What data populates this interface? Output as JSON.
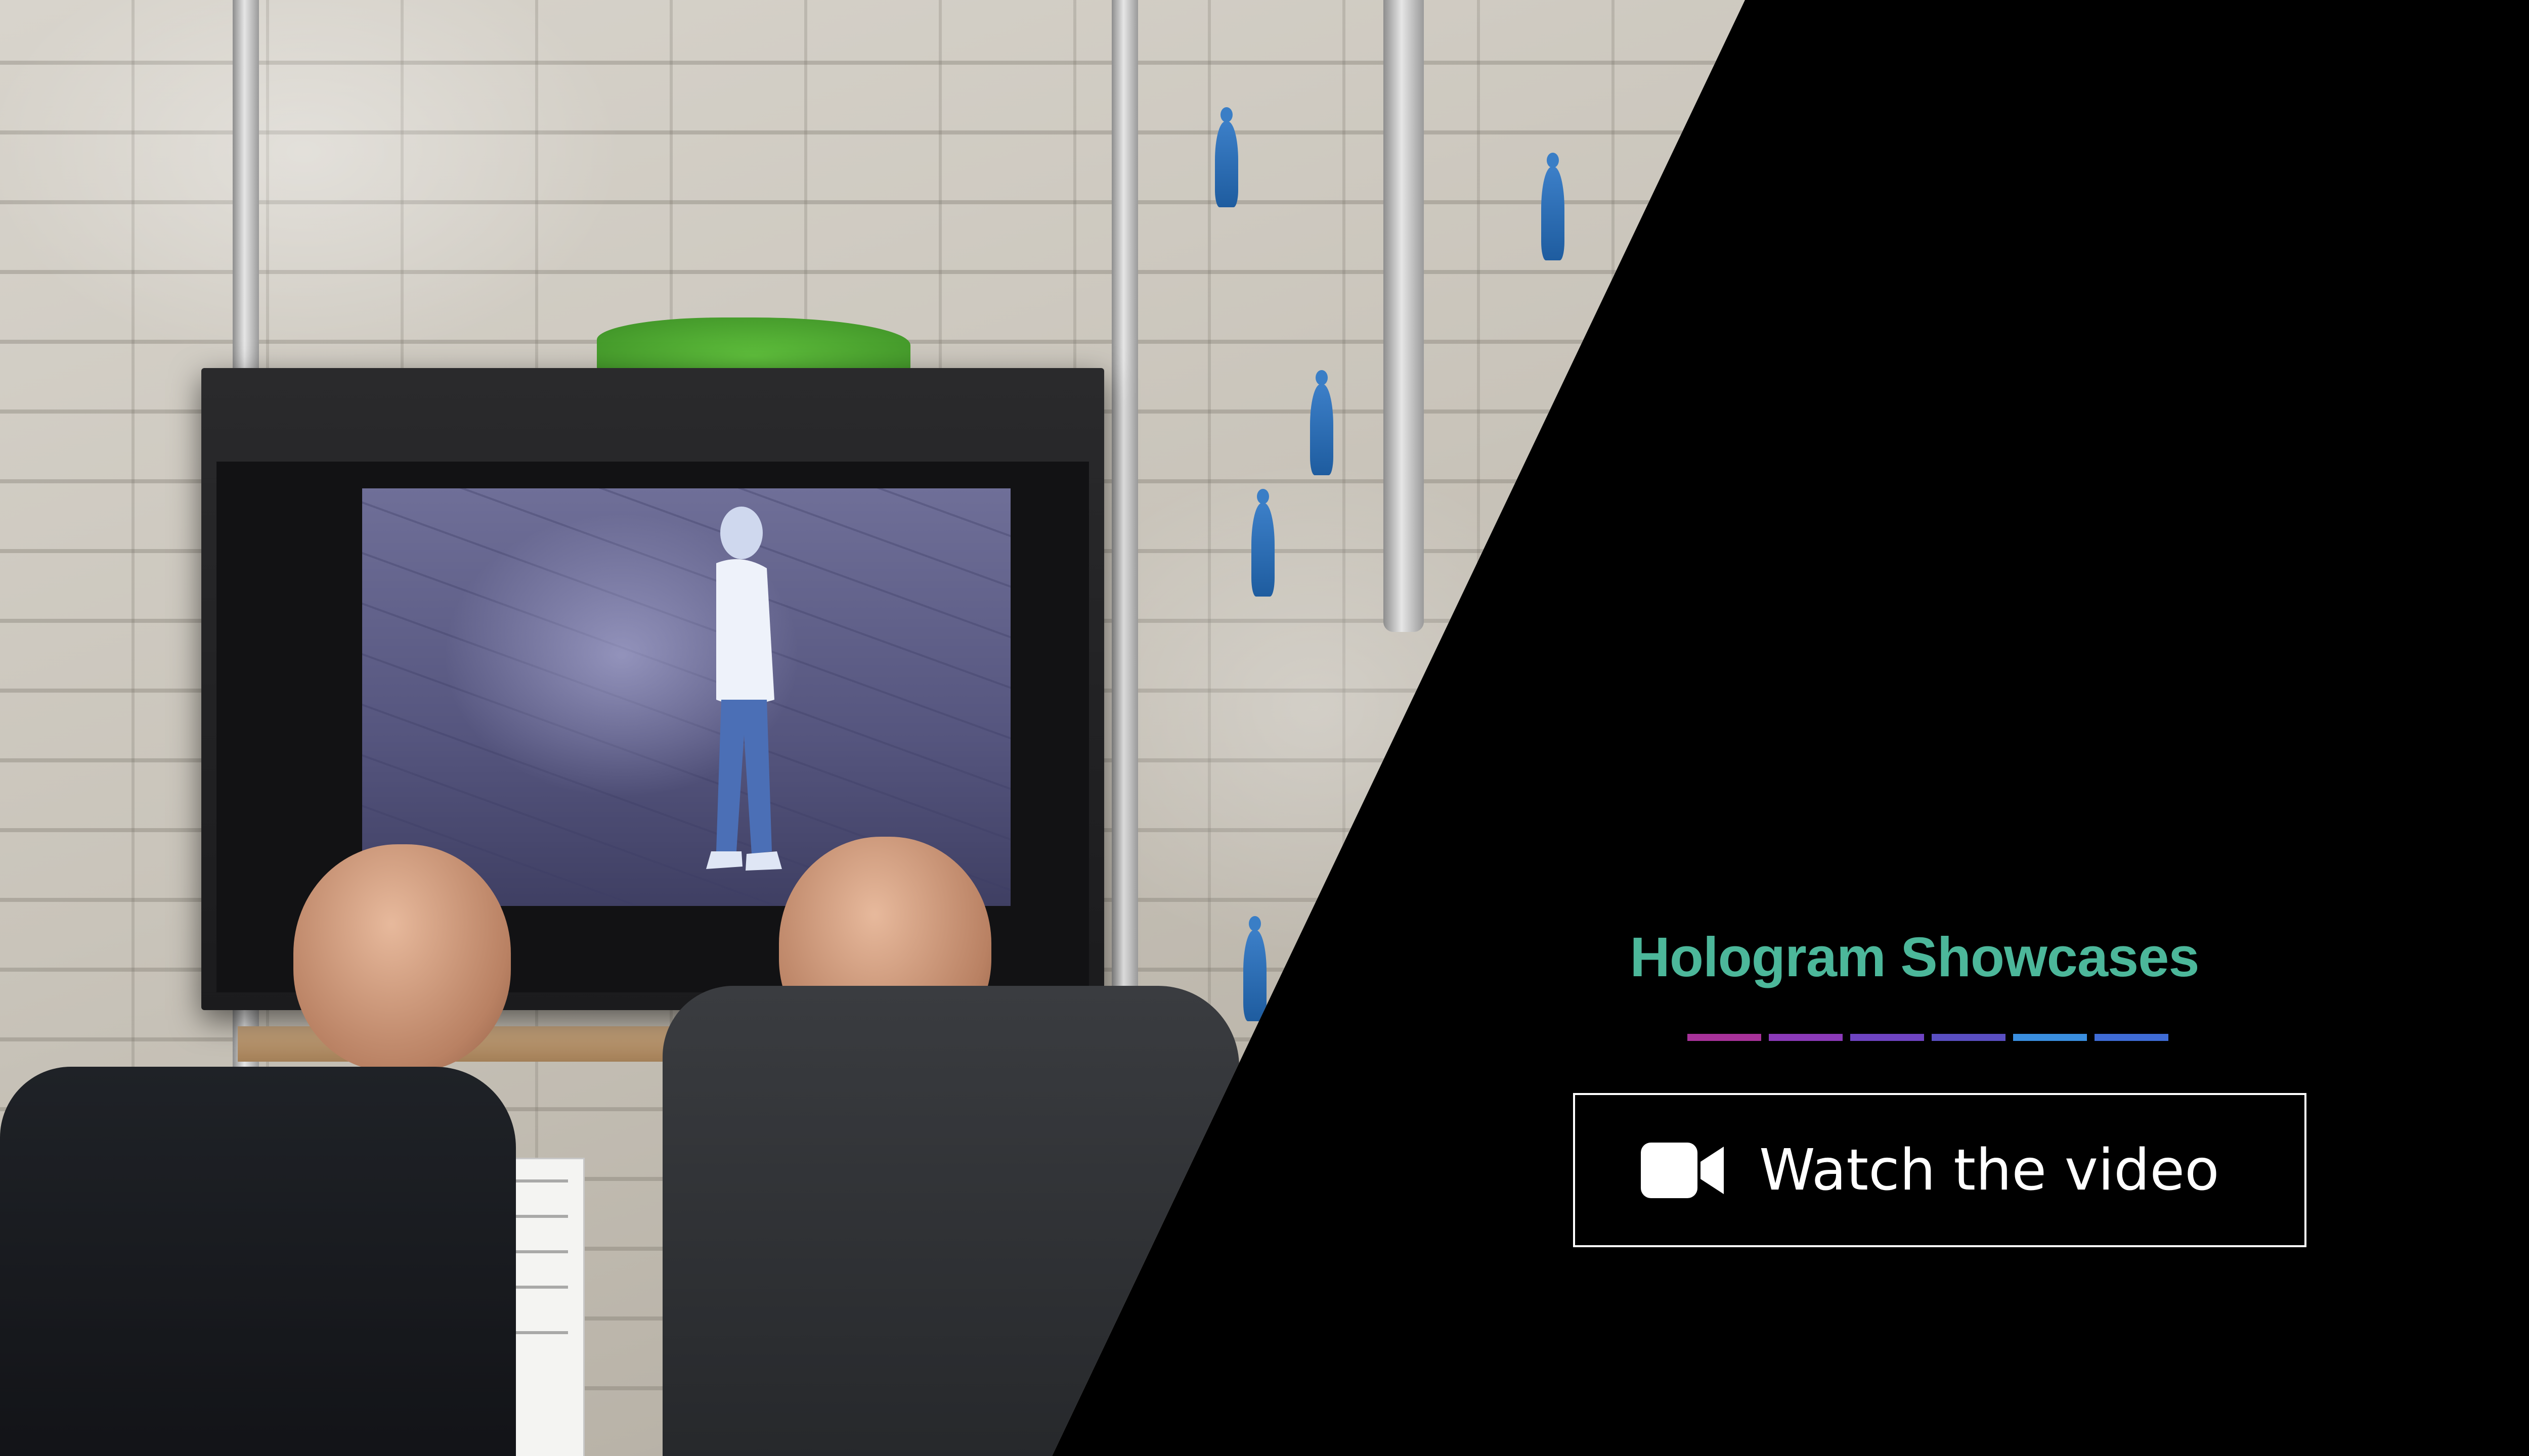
{
  "slide": {
    "title": "Hologram Showcases",
    "title_color": "#4cb79a",
    "background_color": "#000000",
    "divider_colors": [
      "#a8329a",
      "#8b3ab9",
      "#6f44c2",
      "#5a4fc2",
      "#3a8fe0",
      "#3f6cd6"
    ],
    "cta": {
      "label": "Watch the video",
      "icon": "video-camera-icon",
      "border_color": "#ffffff"
    }
  },
  "photo": {
    "description_icon": "photo-hologram-display"
  }
}
